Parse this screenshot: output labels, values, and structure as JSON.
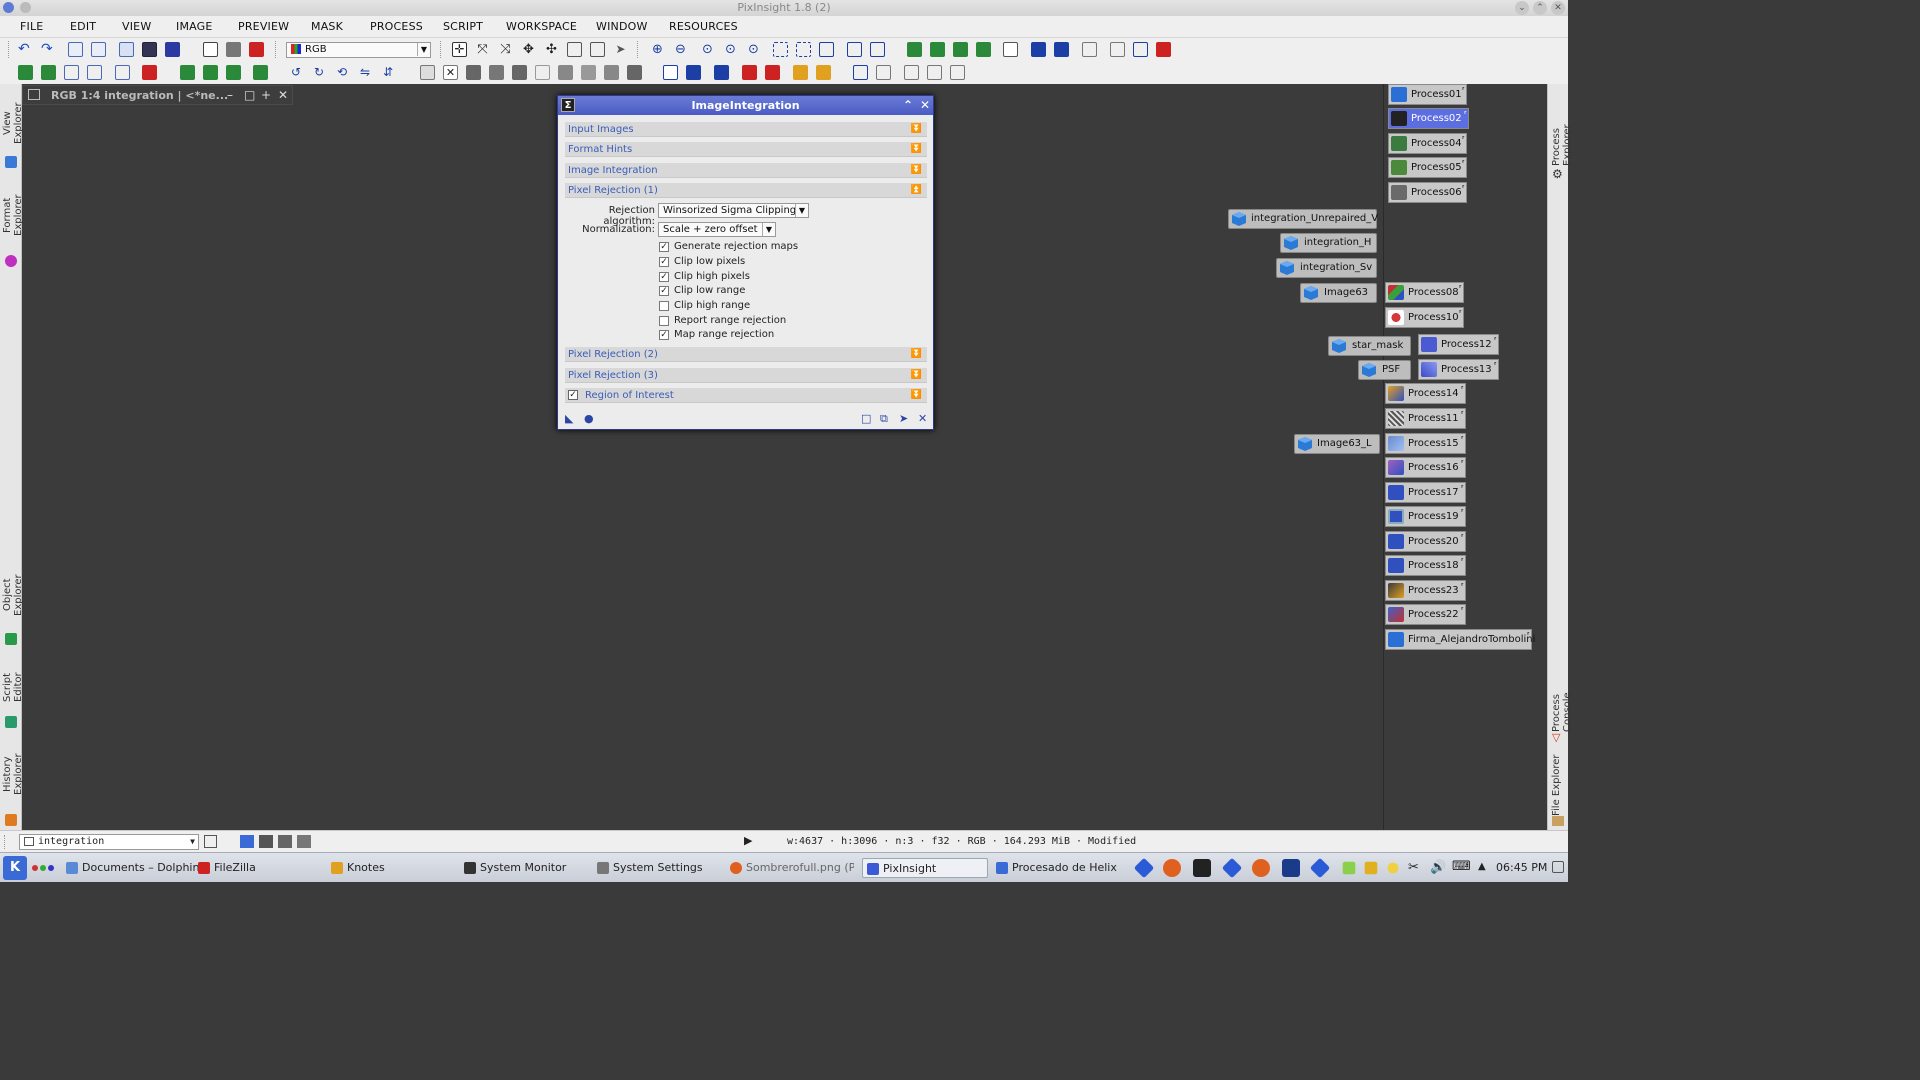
{
  "window": {
    "title": "PixInsight 1.8 (2)"
  },
  "menu": [
    "FILE",
    "EDIT",
    "VIEW",
    "IMAGE",
    "PREVIEW",
    "MASK",
    "PROCESS",
    "SCRIPT",
    "WORKSPACE",
    "WINDOW",
    "RESOURCES"
  ],
  "toolbar": {
    "channel_select": "RGB"
  },
  "left_dock": [
    "View Explorer",
    "Format Explorer",
    "Object Explorer",
    "Script Editor",
    "History Explorer"
  ],
  "right_dock": [
    "Process Explorer",
    "Process Console",
    "File Explorer"
  ],
  "image_window": {
    "title": "RGB 1:4 integration | <*ne..."
  },
  "dialog": {
    "title": "ImageIntegration",
    "sections_top": [
      "Input Images",
      "Format Hints",
      "Image Integration",
      "Pixel Rejection (1)"
    ],
    "rejection_label": "Rejection algorithm:",
    "rejection_value": "Winsorized Sigma Clipping",
    "normalization_label": "Normalization:",
    "normalization_value": "Scale + zero offset",
    "checkboxes": [
      {
        "label": "Generate rejection maps",
        "checked": true
      },
      {
        "label": "Clip low pixels",
        "checked": true
      },
      {
        "label": "Clip high pixels",
        "checked": true
      },
      {
        "label": "Clip low range",
        "checked": true
      },
      {
        "label": "Clip high range",
        "checked": false
      },
      {
        "label": "Report range rejection",
        "checked": false
      },
      {
        "label": "Map range rejection",
        "checked": true
      }
    ],
    "sections_bottom": [
      "Pixel Rejection (2)",
      "Pixel Rejection (3)"
    ],
    "roi_label": "Region of Interest",
    "roi_checked": true
  },
  "process_icons": [
    {
      "name": "Process01",
      "color": "#2a6fd6"
    },
    {
      "name": "Process02",
      "color": "#222222",
      "selected": true
    },
    {
      "name": "Process04",
      "color": "#3b7b3f"
    },
    {
      "name": "Process05",
      "color": "#4a8a3a"
    },
    {
      "name": "Process06",
      "color": "#6a6a6a"
    },
    {
      "name": "Process08",
      "color": "#c03030"
    },
    {
      "name": "Process10",
      "color": "#d43a3a"
    },
    {
      "name": "Process12",
      "color": "#4a5ad0"
    },
    {
      "name": "Process13",
      "color": "#3a4ac8"
    },
    {
      "name": "Process14",
      "color": "#e0a020"
    },
    {
      "name": "Process11",
      "color": "#555555"
    },
    {
      "name": "Process15",
      "color": "#6a8ad0"
    },
    {
      "name": "Process16",
      "color": "#a060c0"
    },
    {
      "name": "Process17",
      "color": "#3050c0"
    },
    {
      "name": "Process19",
      "color": "#3050c0"
    },
    {
      "name": "Process20",
      "color": "#3050c0"
    },
    {
      "name": "Process18",
      "color": "#3050c0"
    },
    {
      "name": "Process23",
      "color": "#3a3a3a"
    },
    {
      "name": "Process22",
      "color": "#4060c8"
    },
    {
      "name": "Firma_AlejandroTombolini",
      "color": "#2a6fd6"
    }
  ],
  "image_icons": [
    "integration_Unrepaired_V",
    "integration_H",
    "integration_Sv",
    "Image63",
    "star_mask",
    "PSF",
    "Image63_L"
  ],
  "statusbar": {
    "view": "integration",
    "info": "w:4637 · h:3096 · n:3 · f32 · RGB · 164.293 MiB · Modified"
  },
  "taskbar": {
    "tasks": [
      "Documents – Dolphin",
      "FileZilla",
      "Knotes",
      "System Monitor",
      "System Settings",
      "Sombrerofull.png (PN…",
      "PixInsight",
      "Procesado de Helix co…"
    ],
    "clock": "06:45 PM"
  }
}
